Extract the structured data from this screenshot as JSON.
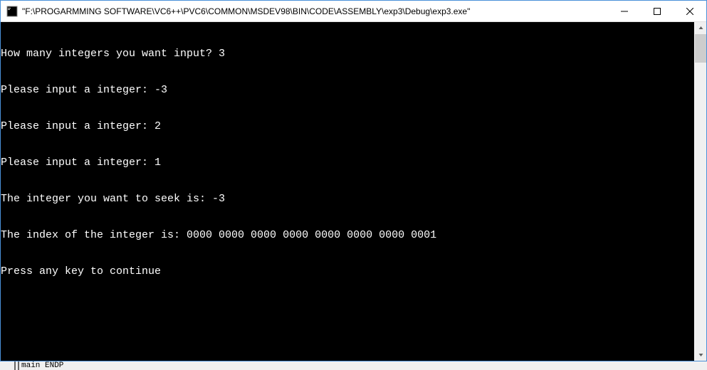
{
  "window": {
    "title": "\"F:\\PROGARMMING SOFTWARE\\VC6++\\PVC6\\COMMON\\MSDEV98\\BIN\\CODE\\ASSEMBLY\\exp3\\Debug\\exp3.exe\""
  },
  "console": {
    "lines": [
      "How many integers you want input? 3",
      "Please input a integer: -3",
      "Please input a integer: 2",
      "Please input a integer: 1",
      "The integer you want to seek is: -3",
      "The index of the integer is: 0000 0000 0000 0000 0000 0000 0000 0001",
      "Press any key to continue"
    ]
  },
  "fragment": {
    "text": "main ENDP"
  }
}
